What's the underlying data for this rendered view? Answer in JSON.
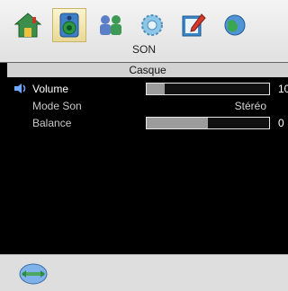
{
  "top_menu": {
    "icons": [
      {
        "name": "home-icon"
      },
      {
        "name": "speaker-icon",
        "selected": true
      },
      {
        "name": "network-icon"
      },
      {
        "name": "settings-icon"
      },
      {
        "name": "edit-icon"
      },
      {
        "name": "globe-icon"
      }
    ],
    "title": "SON"
  },
  "submenu": {
    "title": "Casque",
    "items": [
      {
        "label": "Volume",
        "type": "slider",
        "level_percent": 15,
        "value": "10",
        "active": true
      },
      {
        "label": "Mode Son",
        "type": "option",
        "value": "Stéréo"
      },
      {
        "label": "Balance",
        "type": "slider",
        "level_percent": 50,
        "value": "0"
      }
    ]
  },
  "bottom": {
    "icon": "navigation-globe-icon"
  }
}
